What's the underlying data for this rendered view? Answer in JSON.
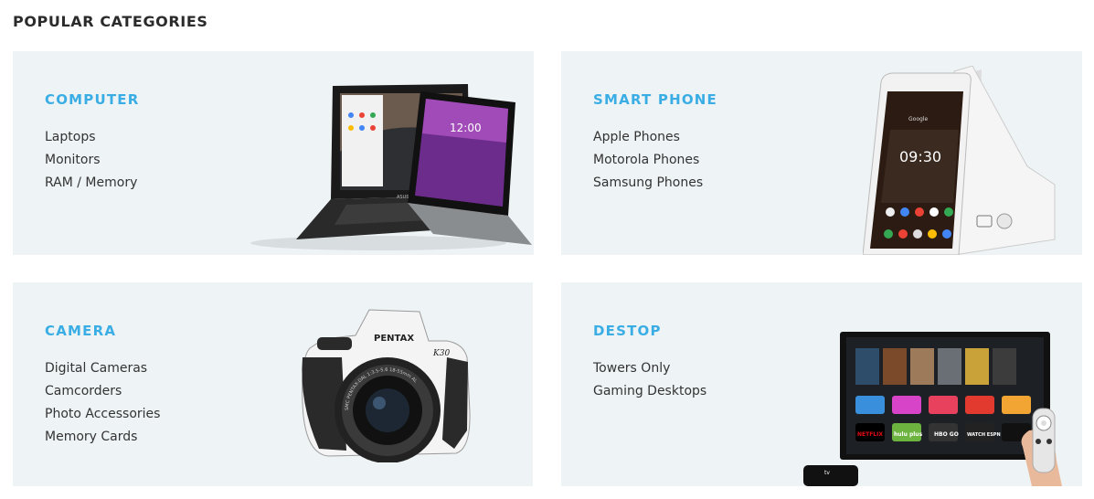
{
  "section": {
    "title": "POPULAR CATEGORIES"
  },
  "categories": [
    {
      "title": "COMPUTER",
      "links": [
        "Laptops",
        "Monitors",
        "RAM / Memory"
      ],
      "image": "laptop-tablet-image"
    },
    {
      "title": "SMART PHONE",
      "links": [
        "Apple Phones",
        "Motorola Phones",
        "Samsung Phones"
      ],
      "image": "smartphone-image"
    },
    {
      "title": "CAMERA",
      "links": [
        "Digital Cameras",
        "Camcorders",
        "Photo Accessories",
        "Memory Cards"
      ],
      "image": "dslr-camera-image"
    },
    {
      "title": "DESTOP",
      "links": [
        "Towers Only",
        "Gaming Desktops"
      ],
      "image": "tv-remote-image"
    }
  ],
  "image_text": {
    "laptop_brand": "ASUS",
    "tablet_time": "12:00",
    "phone_time": "09:30",
    "phone_carrier": "Google",
    "camera_brand": "PENTAX",
    "camera_model": "K30",
    "camera_lens": "SMC PENTAX-DAL 1:3.5-5.6 18-55mm AL",
    "tv_app_1": "NETFLIX",
    "tv_app_2": "hulu plus",
    "tv_app_3": "HBO GO",
    "tv_app_4": "WATCH ESPN",
    "tv_brand": "tv"
  },
  "colors": {
    "accent": "#3aaee4",
    "card_bg": "#eef3f6",
    "text": "#333333",
    "heading": "#2b2b2b"
  }
}
